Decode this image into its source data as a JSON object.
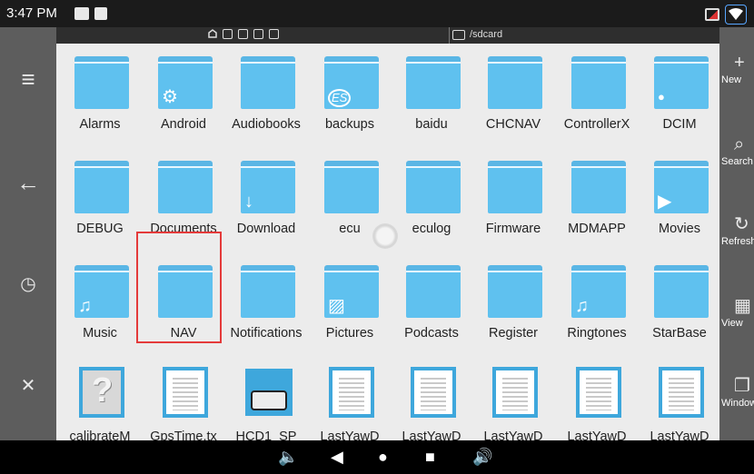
{
  "status_bar": {
    "time": "3:47 PM"
  },
  "path_bar": {
    "path": "/sdcard"
  },
  "left_rail": [
    "menu-icon",
    "back-arrow-icon",
    "history-icon",
    "close-icon"
  ],
  "right_rail": [
    {
      "label": "New",
      "icon": "plus-icon",
      "glyph": "+"
    },
    {
      "label": "Search",
      "icon": "search-icon",
      "glyph": "⌕"
    },
    {
      "label": "Refresh",
      "icon": "refresh-icon",
      "glyph": "↻"
    },
    {
      "label": "View",
      "icon": "grid-view-icon",
      "glyph": "▦"
    },
    {
      "label": "Window",
      "icon": "window-icon",
      "glyph": "❐"
    }
  ],
  "files": [
    {
      "name": "Alarms",
      "kind": "folder"
    },
    {
      "name": "Android",
      "kind": "folder",
      "badge": "⚙"
    },
    {
      "name": "Audiobooks",
      "kind": "folder"
    },
    {
      "name": "backups",
      "kind": "folder",
      "badge": "ES"
    },
    {
      "name": "baidu",
      "kind": "folder"
    },
    {
      "name": "CHCNAV",
      "kind": "folder"
    },
    {
      "name": "ControllerX",
      "kind": "folder"
    },
    {
      "name": "DCIM",
      "kind": "folder",
      "badge": "●"
    },
    {
      "name": "DEBUG",
      "kind": "folder"
    },
    {
      "name": "Documents",
      "kind": "folder"
    },
    {
      "name": "Download",
      "kind": "folder",
      "badge": "↓"
    },
    {
      "name": "ecu",
      "kind": "folder"
    },
    {
      "name": "eculog",
      "kind": "folder"
    },
    {
      "name": "Firmware",
      "kind": "folder"
    },
    {
      "name": "MDMAPP",
      "kind": "folder"
    },
    {
      "name": "Movies",
      "kind": "folder",
      "badge": "▶"
    },
    {
      "name": "Music",
      "kind": "folder",
      "badge": "♫"
    },
    {
      "name": "NAV",
      "kind": "folder",
      "selected": true
    },
    {
      "name": "Notifications",
      "kind": "folder"
    },
    {
      "name": "Pictures",
      "kind": "folder",
      "badge": "▨"
    },
    {
      "name": "Podcasts",
      "kind": "folder"
    },
    {
      "name": "Register",
      "kind": "folder"
    },
    {
      "name": "Ringtones",
      "kind": "folder",
      "badge": "♫"
    },
    {
      "name": "StarBase",
      "kind": "folder"
    },
    {
      "name": "calibrateM",
      "kind": "unknown"
    },
    {
      "name": "GpsTime.tx",
      "kind": "text"
    },
    {
      "name": "HCD1_SP",
      "kind": "book"
    },
    {
      "name": "LastYawD",
      "kind": "text"
    },
    {
      "name": "LastYawD",
      "kind": "text"
    },
    {
      "name": "LastYawD",
      "kind": "text"
    },
    {
      "name": "LastYawD",
      "kind": "text"
    },
    {
      "name": "LastYawD",
      "kind": "text"
    }
  ],
  "nav_bar": [
    "volume-down-icon",
    "back-icon",
    "home-icon",
    "recents-icon",
    "volume-up-icon"
  ]
}
